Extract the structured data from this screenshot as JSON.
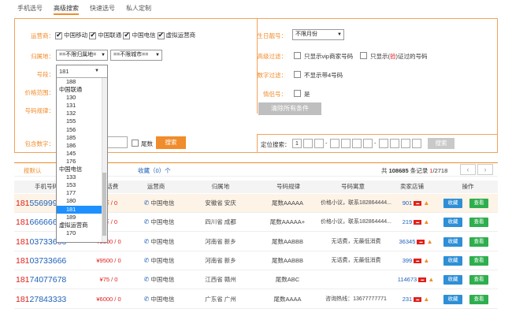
{
  "tabs": [
    "手机选号",
    "高级搜索",
    "快速选号",
    "私人定制"
  ],
  "filters": {
    "carrier_label": "运营商：",
    "carriers": [
      "中国移动",
      "中国联通",
      "中国电信",
      "虚拟运营商"
    ],
    "region_label": "归属地：",
    "province_value": "==不限归属地=",
    "city_value": "==不限城市==",
    "segment_label": "号段：",
    "segment_value": "181",
    "price_label": "价格范围：",
    "rule_label": "号码规律：",
    "contain_label": "包含数字：",
    "tail_label": "尾数",
    "search_btn": "搜索",
    "birthday_label": "生日靓号：",
    "birthday_value": "不限月份",
    "advanced_label": "高级过滤：",
    "vip_text": "只显示vip商家号码",
    "verified_pre": "只显示(",
    "verified_mark": "验",
    "verified_post": ")证过的号码",
    "digit_label": "数字过滤：",
    "no4_text": "不显示带4号码",
    "love_label": "情侣号：",
    "love_text": "是",
    "clear_btn": "清除所有条件",
    "locate_label": "定位搜索：",
    "locate_first": "1",
    "locate_search": "搜索"
  },
  "dropdown": {
    "items": [
      {
        "t": "188",
        "g": false
      },
      {
        "t": "中国联通",
        "g": true
      },
      {
        "t": "130",
        "g": false
      },
      {
        "t": "131",
        "g": false
      },
      {
        "t": "132",
        "g": false
      },
      {
        "t": "155",
        "g": false
      },
      {
        "t": "156",
        "g": false
      },
      {
        "t": "185",
        "g": false
      },
      {
        "t": "186",
        "g": false
      },
      {
        "t": "145",
        "g": false
      },
      {
        "t": "176",
        "g": false
      },
      {
        "t": "中国电信",
        "g": true
      },
      {
        "t": "133",
        "g": false
      },
      {
        "t": "153",
        "g": false
      },
      {
        "t": "177",
        "g": false
      },
      {
        "t": "180",
        "g": false
      },
      {
        "t": "181",
        "g": false,
        "on": true
      },
      {
        "t": "189",
        "g": false
      },
      {
        "t": "虚拟运营商",
        "g": true
      },
      {
        "t": "170",
        "g": false
      }
    ]
  },
  "toolbar": {
    "sort_default": "按默认",
    "fav_pre": "收藏（",
    "fav_count": "0",
    "fav_post": "）个",
    "total_pre": "共",
    "total_count": "108685",
    "total_post": "条记录",
    "page_current": "1",
    "page_total": "/2718",
    "prev": "‹",
    "next": "›"
  },
  "columns": [
    "手机号码",
    "价/话费",
    "运营商",
    "归属地",
    "号码规律",
    "号码寓意",
    "卖家店铺",
    "操作"
  ],
  "rows": [
    {
      "pre": "181",
      "rest": "5569999",
      "price": "0万 / 0",
      "carrier": "中国电信",
      "region": "安徽省 安庆",
      "rule": "尾数AAAAA",
      "meaning": "价格小议，联系182864444...",
      "shop": "901"
    },
    {
      "pre": "181",
      "rest": "666666",
      "price": "0万 / 0",
      "carrier": "中国电信",
      "region": "四川省 成都",
      "rule": "尾数AAAAA+",
      "meaning": "价格小议，联系182864444...",
      "shop": "219"
    },
    {
      "pre": "181",
      "rest": "03733666",
      "price": "¥9500 / 0",
      "carrier": "中国电信",
      "region": "河南省 新乡",
      "rule": "尾数AABBB",
      "meaning": "无话费，无最低消费",
      "shop": "36345"
    },
    {
      "pre": "181",
      "rest": "03733666",
      "price": "¥9500 / 0",
      "carrier": "中国电信",
      "region": "河南省 新乡",
      "rule": "尾数AABBB",
      "meaning": "无话费，无最低消费",
      "shop": "399"
    },
    {
      "pre": "181",
      "rest": "74077678",
      "price": "¥75 / 0",
      "carrier": "中国电信",
      "region": "江西省 赣州",
      "rule": "尾数ABC",
      "meaning": "",
      "shop": "114673"
    },
    {
      "pre": "181",
      "rest": "27843333",
      "price": "¥6000 / 0",
      "carrier": "中国电信",
      "region": "广东省 广州",
      "rule": "尾数AAAA",
      "meaning": "咨询热线：13677777771",
      "shop": "231"
    }
  ],
  "row_actions": {
    "fav": "收藏",
    "view": "查看"
  },
  "colors": {
    "accent": "#f08c2b",
    "link": "#1f61b9",
    "red": "#e0201a"
  }
}
